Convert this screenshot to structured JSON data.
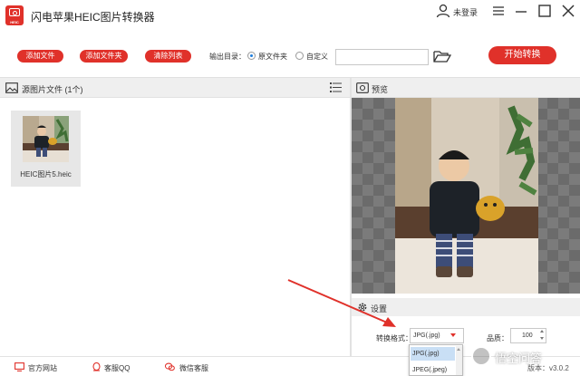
{
  "app": {
    "title": "闪电苹果HEIC图片转换器",
    "logo_tag": "HEIC",
    "user_label": "未登录"
  },
  "toolbar": {
    "add_file": "添加文件",
    "add_folder": "添加文件夹",
    "clear_list": "清除列表",
    "output_dir_label": "输出目录：",
    "radio_original": "原文件夹",
    "radio_custom": "自定义",
    "selected_output": "原文件夹",
    "path_value": "",
    "start_convert": "开始转换"
  },
  "file_panel": {
    "title": "源图片文件 (1个)",
    "files": [
      {
        "name": "HEIC图片5.heic"
      }
    ]
  },
  "preview_panel": {
    "title": "预览"
  },
  "settings": {
    "title": "设置",
    "format_label": "转换格式：",
    "format_value": "JPG(.jpg)",
    "format_options": [
      "JPG(.jpg)",
      "JPEG(.jpeg)"
    ],
    "quality_label": "品质：",
    "quality_value": "100"
  },
  "statusbar": {
    "website": "官方网站",
    "qq": "客服QQ",
    "wechat": "微信客服",
    "version": "版本：v3.0.2"
  },
  "watermark": {
    "text": "悟空问答"
  },
  "colors": {
    "accent": "#e0312a",
    "panel_header": "#efefef",
    "selected_option": "#c9dff5"
  }
}
